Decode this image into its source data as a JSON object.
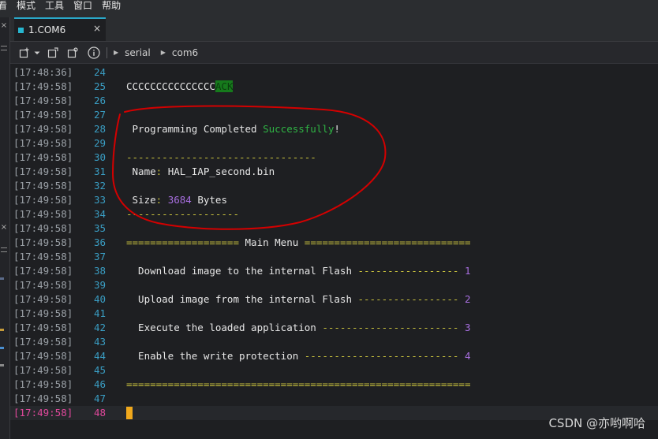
{
  "menu": [
    "看",
    "模式",
    "工具",
    "窗口",
    "帮助"
  ],
  "tab": {
    "label": "1.COM6",
    "close": "×"
  },
  "left_strip_close": "×",
  "toolbar": {
    "breadcrumb": [
      "serial",
      "com6"
    ]
  },
  "colors": {
    "timestamp": "#9aa0a6",
    "line_number": "#3a9ec4",
    "current_line": "#e0489b",
    "success": "#2fb344",
    "dash_yellow": "#c9c23e",
    "number_purple": "#a86fe0",
    "cursor": "#f0a81c",
    "annotation_circle": "#d40000"
  },
  "terminal": {
    "rows": [
      {
        "ts": "[17:48:36]",
        "ln": "24",
        "text": ""
      },
      {
        "ts": "[17:49:58]",
        "ln": "25",
        "text": "CCCCCCCCCCCCCCC",
        "tag": "ACK"
      },
      {
        "ts": "[17:49:58]",
        "ln": "26",
        "text": ""
      },
      {
        "ts": "[17:49:58]",
        "ln": "27",
        "text": ""
      },
      {
        "ts": "[17:49:58]",
        "ln": "28",
        "text": " Programming Completed ",
        "success": "Successfully",
        "tail": "!"
      },
      {
        "ts": "[17:49:58]",
        "ln": "29",
        "text": ""
      },
      {
        "ts": "[17:49:58]",
        "ln": "30",
        "dashes": "--------------------------------"
      },
      {
        "ts": "[17:49:58]",
        "ln": "31",
        "label": " Name",
        "colon": ":",
        "value": " HAL_IAP_second.bin"
      },
      {
        "ts": "[17:49:58]",
        "ln": "32",
        "text": ""
      },
      {
        "ts": "[17:49:58]",
        "ln": "33",
        "label": " Size",
        "colon": ":",
        "num": " 3684",
        "value": " Bytes"
      },
      {
        "ts": "[17:49:58]",
        "ln": "34",
        "dashes": "-------------------"
      },
      {
        "ts": "[17:49:58]",
        "ln": "35",
        "text": ""
      },
      {
        "ts": "[17:49:58]",
        "ln": "36",
        "eq_left": "===================",
        "title": " Main Menu ",
        "eq_right": "============================"
      },
      {
        "ts": "[17:49:58]",
        "ln": "37",
        "text": ""
      },
      {
        "ts": "[17:49:58]",
        "ln": "38",
        "item": "  Download image to the internal Flash ",
        "dashes": "-----------------",
        "num": " 1"
      },
      {
        "ts": "[17:49:58]",
        "ln": "39",
        "text": ""
      },
      {
        "ts": "[17:49:58]",
        "ln": "40",
        "item": "  Upload image from the internal Flash ",
        "dashes": "-----------------",
        "num": " 2"
      },
      {
        "ts": "[17:49:58]",
        "ln": "41",
        "text": ""
      },
      {
        "ts": "[17:49:58]",
        "ln": "42",
        "item": "  Execute the loaded application ",
        "dashes": "-----------------------",
        "num": " 3"
      },
      {
        "ts": "[17:49:58]",
        "ln": "43",
        "text": ""
      },
      {
        "ts": "[17:49:58]",
        "ln": "44",
        "item": "  Enable the write protection ",
        "dashes": "--------------------------",
        "num": " 4"
      },
      {
        "ts": "[17:49:58]",
        "ln": "45",
        "text": ""
      },
      {
        "ts": "[17:49:58]",
        "ln": "46",
        "eq_full": "=========================================================="
      },
      {
        "ts": "[17:49:58]",
        "ln": "47",
        "text": ""
      },
      {
        "ts": "[17:49:58]",
        "ln": "48",
        "text": "",
        "current": true
      }
    ]
  },
  "watermark": "CSDN @亦哟啊哈"
}
